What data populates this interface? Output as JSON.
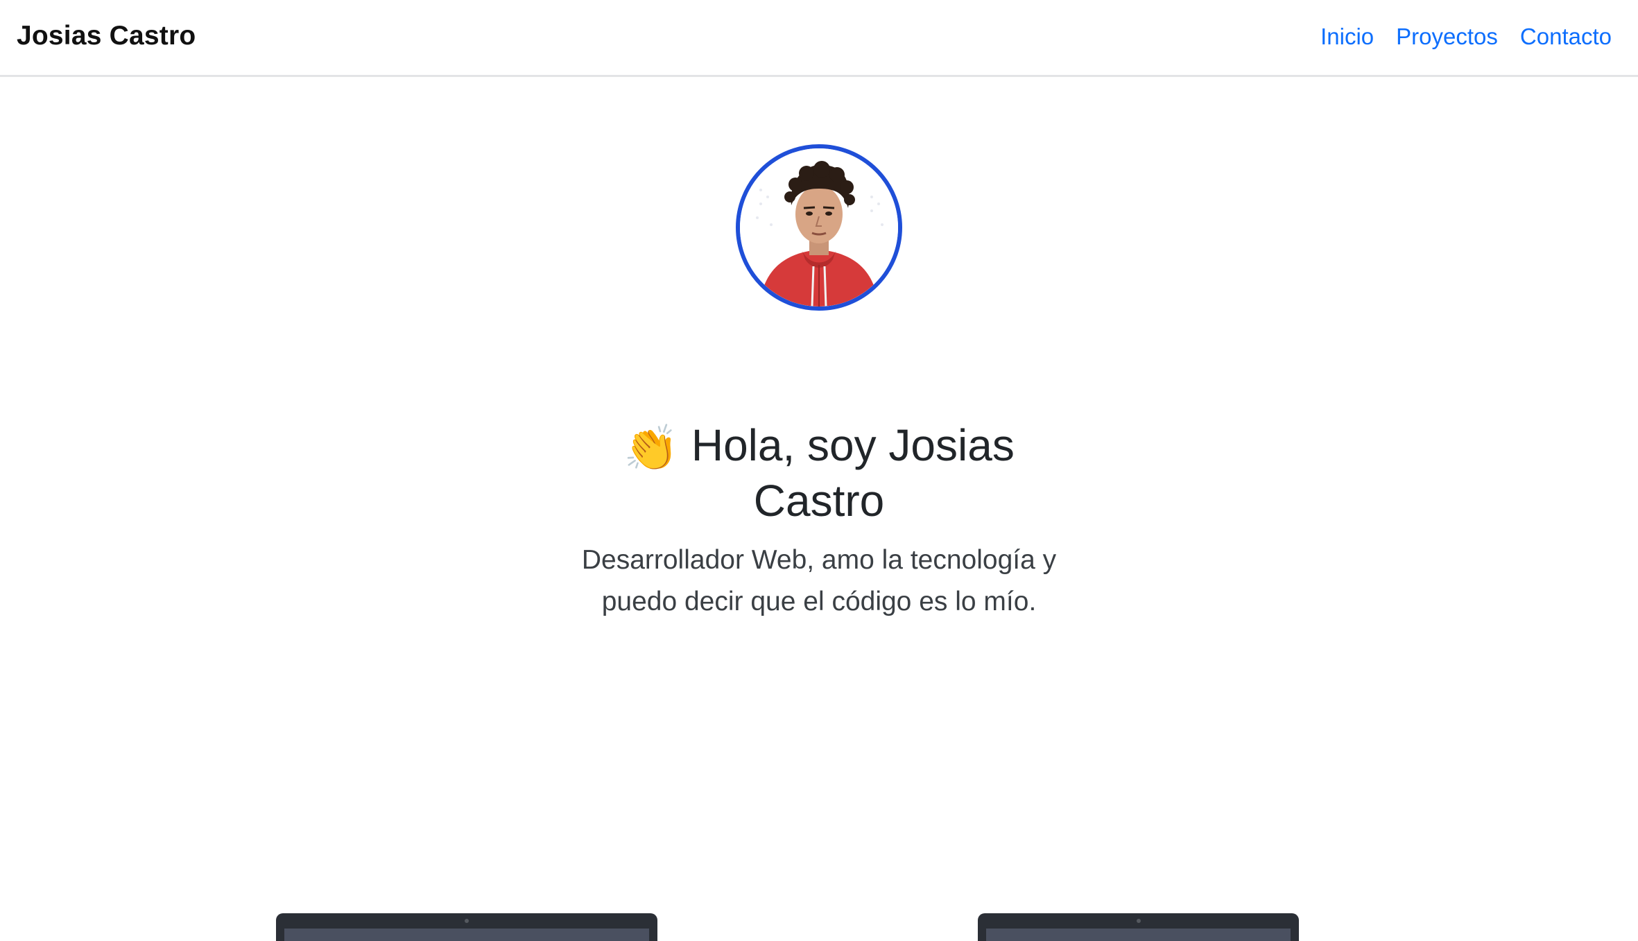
{
  "navbar": {
    "brand": "Josias Castro",
    "links": [
      {
        "label": "Inicio"
      },
      {
        "label": "Proyectos"
      },
      {
        "label": "Contacto"
      }
    ]
  },
  "hero": {
    "wave_emoji": "👏",
    "heading": "Hola, soy Josias Castro",
    "subtitle": "Desarrollador Web, amo la tecnología y puedo decir que el código es lo mío.",
    "avatar_border_color": "#1f4fd8"
  },
  "colors": {
    "link": "#0d6efd",
    "text": "#212529"
  }
}
